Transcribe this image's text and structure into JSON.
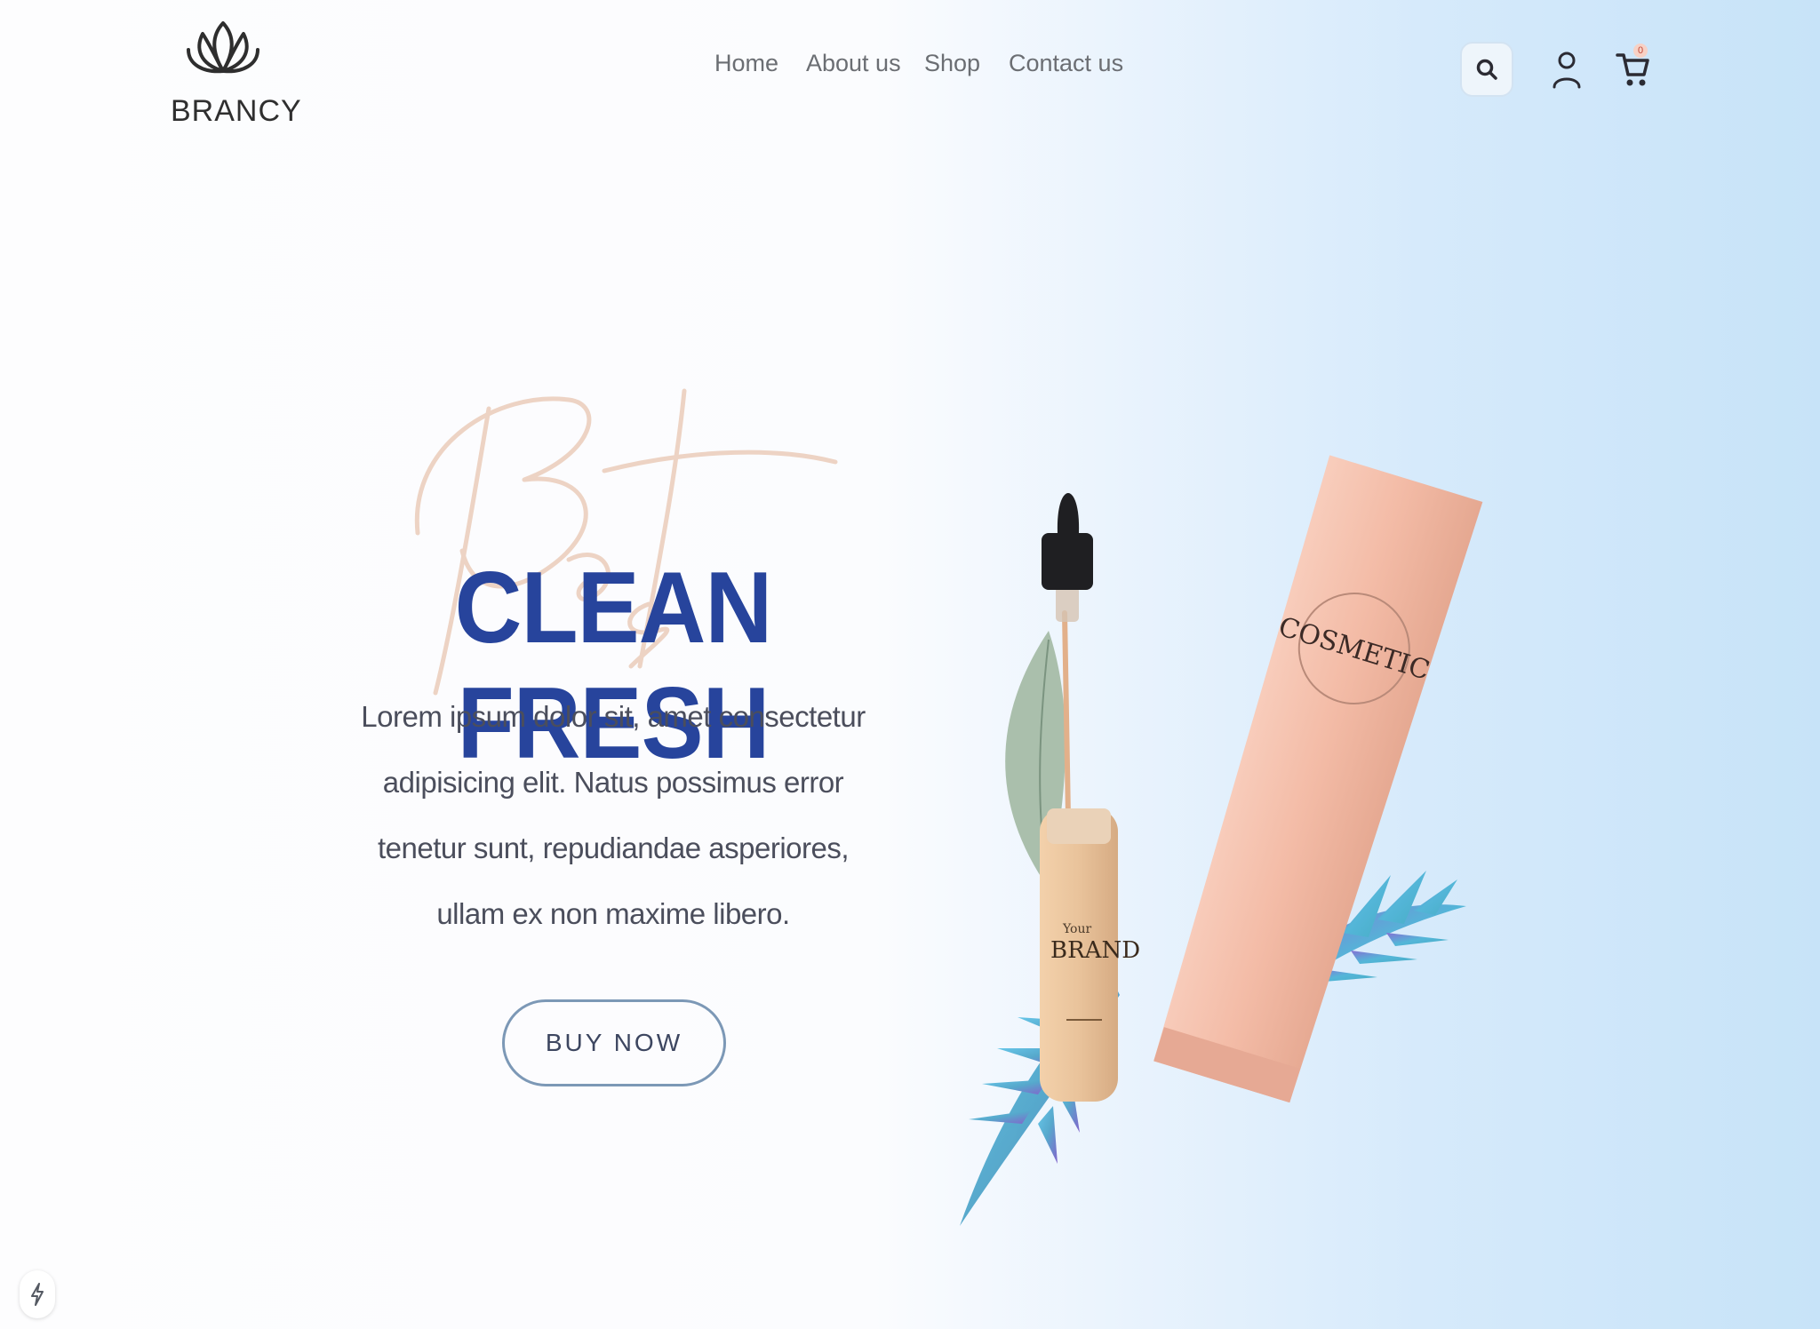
{
  "brand": {
    "logo_text": "BRANCY"
  },
  "nav": {
    "items": [
      {
        "label": "Home"
      },
      {
        "label": "About us"
      },
      {
        "label": "Shop"
      },
      {
        "label": "Contact us"
      }
    ]
  },
  "header_actions": {
    "search_icon": "search-icon",
    "user_icon": "user-icon",
    "cart_icon": "cart-icon",
    "cart_count": "0"
  },
  "hero": {
    "script_word": "Best",
    "title": "CLEAN FRESH",
    "description": "Lorem ipsum dolor sit, amet consectetur adipisicing elit. Natus possimus error tenetur sunt, repudiandae asperiores, ullam ex non maxime libero.",
    "cta_label": "BUY NOW"
  },
  "product_image": {
    "tube_label": "COSMETIC",
    "bottle_label_small": "Your",
    "bottle_label": "BRAND"
  },
  "colors": {
    "accent": "#27449c",
    "script": "#e8c8b6",
    "tube": "#f2b9a4",
    "bottle": "#e9c39b",
    "background_right": "#c7e3f8"
  },
  "floating": {
    "icon": "lightning-icon"
  }
}
